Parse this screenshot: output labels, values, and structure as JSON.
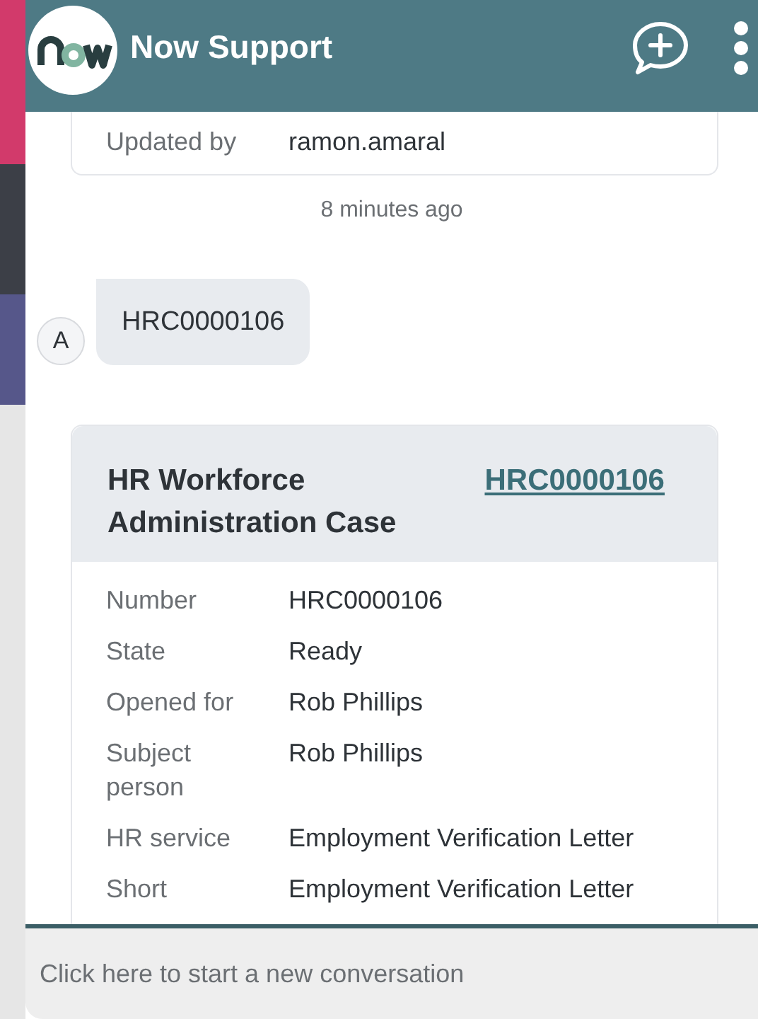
{
  "header": {
    "title": "Now Support"
  },
  "messages": [
    {
      "kind": "record_tail",
      "fields": [
        {
          "label": "Updated by",
          "value": "ramon.amaral"
        }
      ]
    },
    {
      "kind": "timestamp",
      "text": "8 minutes ago"
    },
    {
      "kind": "user",
      "avatar": "A",
      "text": "HRC0000106"
    },
    {
      "kind": "record",
      "title": "HR Workforce Administration Case",
      "link": "HRC0000106",
      "fields": [
        {
          "label": "Number",
          "value": "HRC0000106"
        },
        {
          "label": "State",
          "value": "Ready"
        },
        {
          "label": "Opened for",
          "value": "Rob Phillips"
        },
        {
          "label": "Subject person",
          "value": "Rob Phillips"
        },
        {
          "label": "HR service",
          "value": "Employment Verification Letter"
        },
        {
          "label": "Short",
          "value": "Employment Verification Letter"
        }
      ]
    }
  ],
  "composer": {
    "placeholder": "Click here to start a new conversation"
  }
}
